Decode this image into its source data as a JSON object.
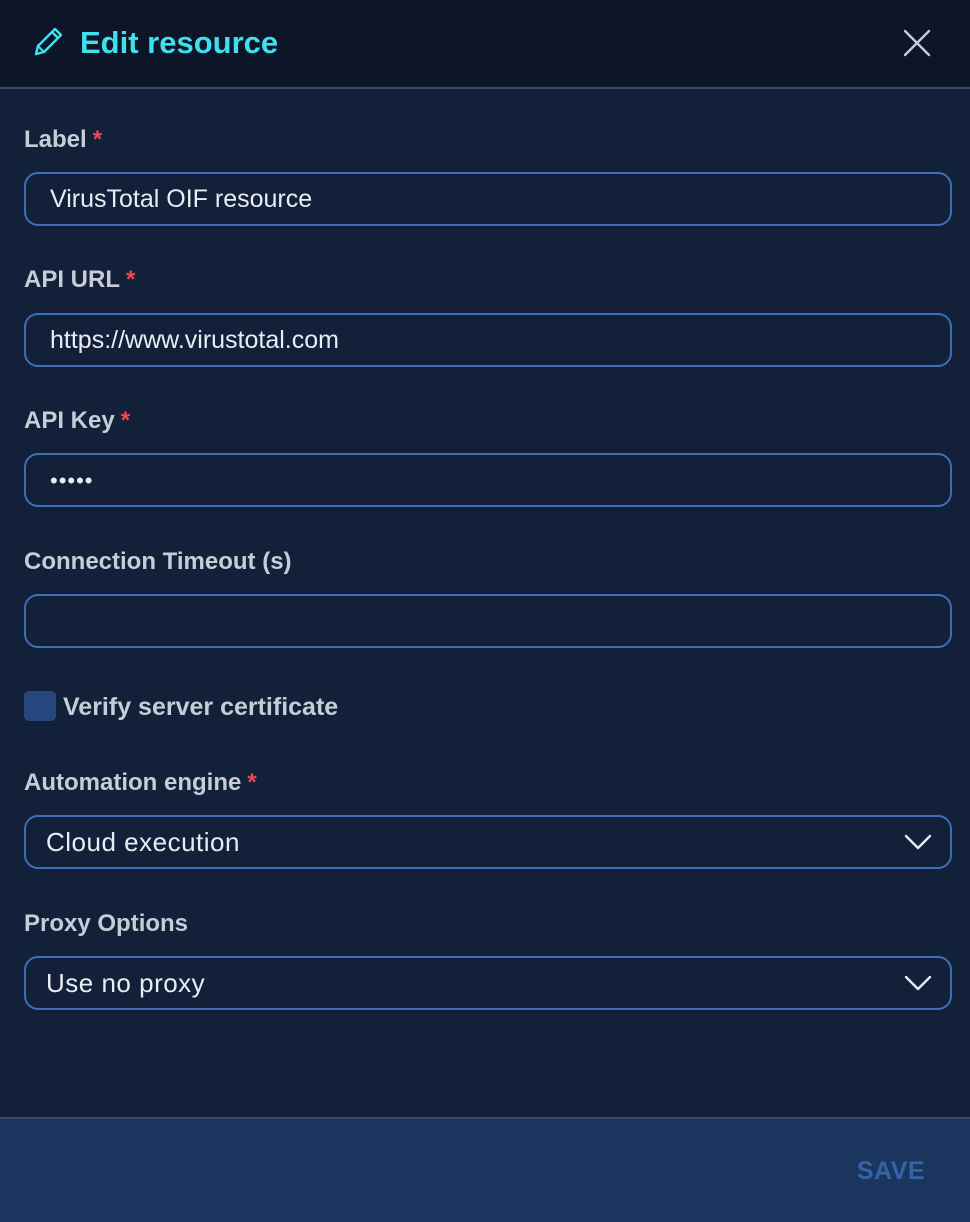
{
  "header": {
    "title": "Edit resource",
    "icon": "pencil-icon",
    "close_icon": "close-icon"
  },
  "form": {
    "label": {
      "label": "Label",
      "required_mark": "*",
      "value": "VirusTotal OIF resource"
    },
    "api_url": {
      "label": "API URL",
      "required_mark": "*",
      "value": "https://www.virustotal.com"
    },
    "api_key": {
      "label": "API Key",
      "required_mark": "*",
      "value": "•••••"
    },
    "connection_timeout": {
      "label": "Connection Timeout (s)",
      "value": ""
    },
    "verify_certificate": {
      "label": "Verify server certificate",
      "checked": false
    },
    "automation_engine": {
      "label": "Automation engine",
      "required_mark": "*",
      "selected": "Cloud execution"
    },
    "proxy_options": {
      "label": "Proxy Options",
      "selected": "Use no proxy"
    }
  },
  "footer": {
    "save_label": "SAVE"
  },
  "colors": {
    "accent": "#3fe0ec",
    "background": "#122039",
    "header_bg": "#0c1628",
    "footer_bg": "#1c355f",
    "input_border": "#3d6fb8",
    "required": "#ef4b4b",
    "save_disabled": "#3464a8"
  }
}
